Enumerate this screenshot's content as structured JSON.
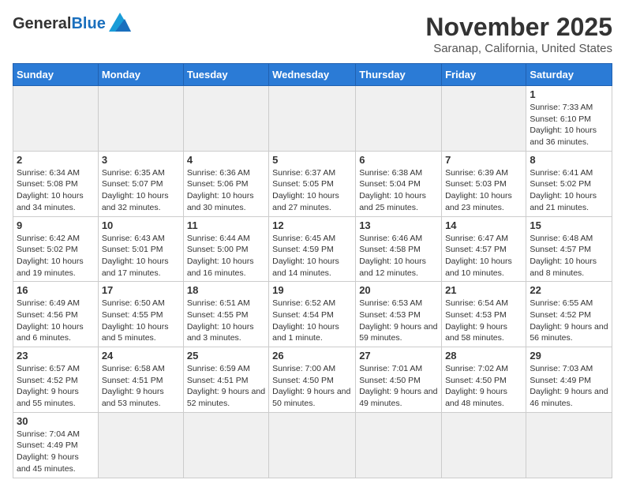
{
  "header": {
    "logo_general": "General",
    "logo_blue": "Blue",
    "month_title": "November 2025",
    "location": "Saranap, California, United States"
  },
  "weekdays": [
    "Sunday",
    "Monday",
    "Tuesday",
    "Wednesday",
    "Thursday",
    "Friday",
    "Saturday"
  ],
  "weeks": [
    [
      {
        "day": "",
        "info": ""
      },
      {
        "day": "",
        "info": ""
      },
      {
        "day": "",
        "info": ""
      },
      {
        "day": "",
        "info": ""
      },
      {
        "day": "",
        "info": ""
      },
      {
        "day": "",
        "info": ""
      },
      {
        "day": "1",
        "info": "Sunrise: 7:33 AM\nSunset: 6:10 PM\nDaylight: 10 hours and 36 minutes."
      }
    ],
    [
      {
        "day": "2",
        "info": "Sunrise: 6:34 AM\nSunset: 5:08 PM\nDaylight: 10 hours and 34 minutes."
      },
      {
        "day": "3",
        "info": "Sunrise: 6:35 AM\nSunset: 5:07 PM\nDaylight: 10 hours and 32 minutes."
      },
      {
        "day": "4",
        "info": "Sunrise: 6:36 AM\nSunset: 5:06 PM\nDaylight: 10 hours and 30 minutes."
      },
      {
        "day": "5",
        "info": "Sunrise: 6:37 AM\nSunset: 5:05 PM\nDaylight: 10 hours and 27 minutes."
      },
      {
        "day": "6",
        "info": "Sunrise: 6:38 AM\nSunset: 5:04 PM\nDaylight: 10 hours and 25 minutes."
      },
      {
        "day": "7",
        "info": "Sunrise: 6:39 AM\nSunset: 5:03 PM\nDaylight: 10 hours and 23 minutes."
      },
      {
        "day": "8",
        "info": "Sunrise: 6:41 AM\nSunset: 5:02 PM\nDaylight: 10 hours and 21 minutes."
      }
    ],
    [
      {
        "day": "9",
        "info": "Sunrise: 6:42 AM\nSunset: 5:02 PM\nDaylight: 10 hours and 19 minutes."
      },
      {
        "day": "10",
        "info": "Sunrise: 6:43 AM\nSunset: 5:01 PM\nDaylight: 10 hours and 17 minutes."
      },
      {
        "day": "11",
        "info": "Sunrise: 6:44 AM\nSunset: 5:00 PM\nDaylight: 10 hours and 16 minutes."
      },
      {
        "day": "12",
        "info": "Sunrise: 6:45 AM\nSunset: 4:59 PM\nDaylight: 10 hours and 14 minutes."
      },
      {
        "day": "13",
        "info": "Sunrise: 6:46 AM\nSunset: 4:58 PM\nDaylight: 10 hours and 12 minutes."
      },
      {
        "day": "14",
        "info": "Sunrise: 6:47 AM\nSunset: 4:57 PM\nDaylight: 10 hours and 10 minutes."
      },
      {
        "day": "15",
        "info": "Sunrise: 6:48 AM\nSunset: 4:57 PM\nDaylight: 10 hours and 8 minutes."
      }
    ],
    [
      {
        "day": "16",
        "info": "Sunrise: 6:49 AM\nSunset: 4:56 PM\nDaylight: 10 hours and 6 minutes."
      },
      {
        "day": "17",
        "info": "Sunrise: 6:50 AM\nSunset: 4:55 PM\nDaylight: 10 hours and 5 minutes."
      },
      {
        "day": "18",
        "info": "Sunrise: 6:51 AM\nSunset: 4:55 PM\nDaylight: 10 hours and 3 minutes."
      },
      {
        "day": "19",
        "info": "Sunrise: 6:52 AM\nSunset: 4:54 PM\nDaylight: 10 hours and 1 minute."
      },
      {
        "day": "20",
        "info": "Sunrise: 6:53 AM\nSunset: 4:53 PM\nDaylight: 9 hours and 59 minutes."
      },
      {
        "day": "21",
        "info": "Sunrise: 6:54 AM\nSunset: 4:53 PM\nDaylight: 9 hours and 58 minutes."
      },
      {
        "day": "22",
        "info": "Sunrise: 6:55 AM\nSunset: 4:52 PM\nDaylight: 9 hours and 56 minutes."
      }
    ],
    [
      {
        "day": "23",
        "info": "Sunrise: 6:57 AM\nSunset: 4:52 PM\nDaylight: 9 hours and 55 minutes."
      },
      {
        "day": "24",
        "info": "Sunrise: 6:58 AM\nSunset: 4:51 PM\nDaylight: 9 hours and 53 minutes."
      },
      {
        "day": "25",
        "info": "Sunrise: 6:59 AM\nSunset: 4:51 PM\nDaylight: 9 hours and 52 minutes."
      },
      {
        "day": "26",
        "info": "Sunrise: 7:00 AM\nSunset: 4:50 PM\nDaylight: 9 hours and 50 minutes."
      },
      {
        "day": "27",
        "info": "Sunrise: 7:01 AM\nSunset: 4:50 PM\nDaylight: 9 hours and 49 minutes."
      },
      {
        "day": "28",
        "info": "Sunrise: 7:02 AM\nSunset: 4:50 PM\nDaylight: 9 hours and 48 minutes."
      },
      {
        "day": "29",
        "info": "Sunrise: 7:03 AM\nSunset: 4:49 PM\nDaylight: 9 hours and 46 minutes."
      }
    ],
    [
      {
        "day": "30",
        "info": "Sunrise: 7:04 AM\nSunset: 4:49 PM\nDaylight: 9 hours and 45 minutes."
      },
      {
        "day": "",
        "info": ""
      },
      {
        "day": "",
        "info": ""
      },
      {
        "day": "",
        "info": ""
      },
      {
        "day": "",
        "info": ""
      },
      {
        "day": "",
        "info": ""
      },
      {
        "day": "",
        "info": ""
      }
    ]
  ]
}
